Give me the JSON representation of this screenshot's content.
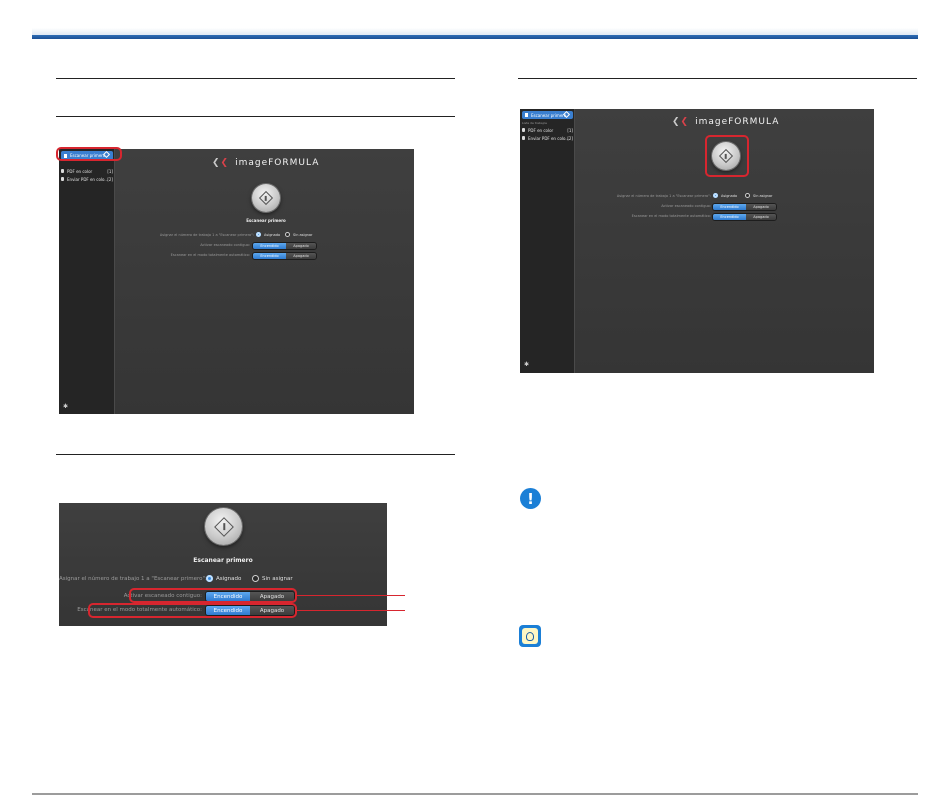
{
  "app": {
    "logo_text": "imageFORMULA",
    "sidebar_selected": "Escanear primero",
    "sidebar_group_header": "Lista de trabajos",
    "job_items": [
      {
        "name": "PDF en color",
        "count": "[1]"
      },
      {
        "name": "Enviar PDF en colo...",
        "count": "[2]"
      }
    ],
    "scan_first_title": "Escanear primero",
    "option_assign_label": "Asignar el número de trabajo 1 a \"Escanear primero\":",
    "option_assign_on": "Asignado",
    "option_assign_off": "Sin asignar",
    "option_continuous_label": "Activar escaneado contiguo:",
    "option_auto_label": "Escanear en el modo totalmente automático:",
    "on_label": "Encendido",
    "off_label": "Apagado"
  },
  "icons": {
    "important": "exclamation-icon",
    "hint": "lightbulb-icon"
  },
  "colors": {
    "highlight": "#d7262f",
    "accent": "#1b7fd6",
    "toggle_on": "#3a8be0"
  }
}
